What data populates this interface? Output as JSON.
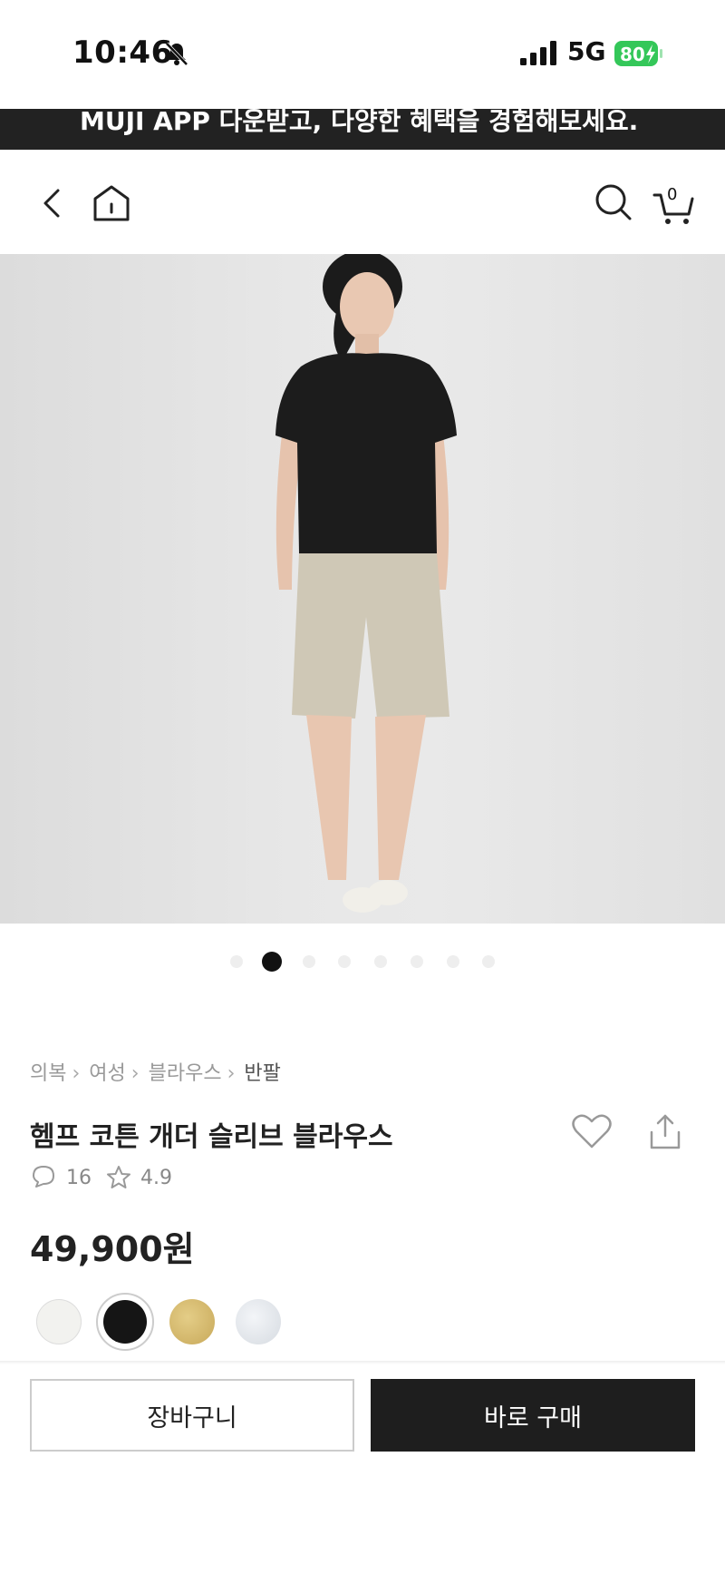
{
  "status_bar": {
    "time": "10:46",
    "network": "5G",
    "battery": "80"
  },
  "promo_banner": {
    "text": "MUJI APP 다운받고, 다양한 혜택을 경험해보세요."
  },
  "nav": {
    "cart_count": "0"
  },
  "gallery": {
    "image_count": 8,
    "active_index": 1
  },
  "breadcrumb": [
    "의복",
    "여성",
    "블라우스",
    "반팔"
  ],
  "product": {
    "title": "헴프 코튼 개더 슬리브 블라우스",
    "review_count": "16",
    "rating": "4.9",
    "price": "49,900원"
  },
  "swatches": [
    {
      "color": "#f2f2ef",
      "selected": false
    },
    {
      "color": "#151515",
      "selected": true
    },
    {
      "color": "#d4b870",
      "selected": false
    },
    {
      "color": "#e3e6ea",
      "selected": false
    }
  ],
  "actions": {
    "cart_label": "장바구니",
    "buy_label": "바로 구매"
  }
}
